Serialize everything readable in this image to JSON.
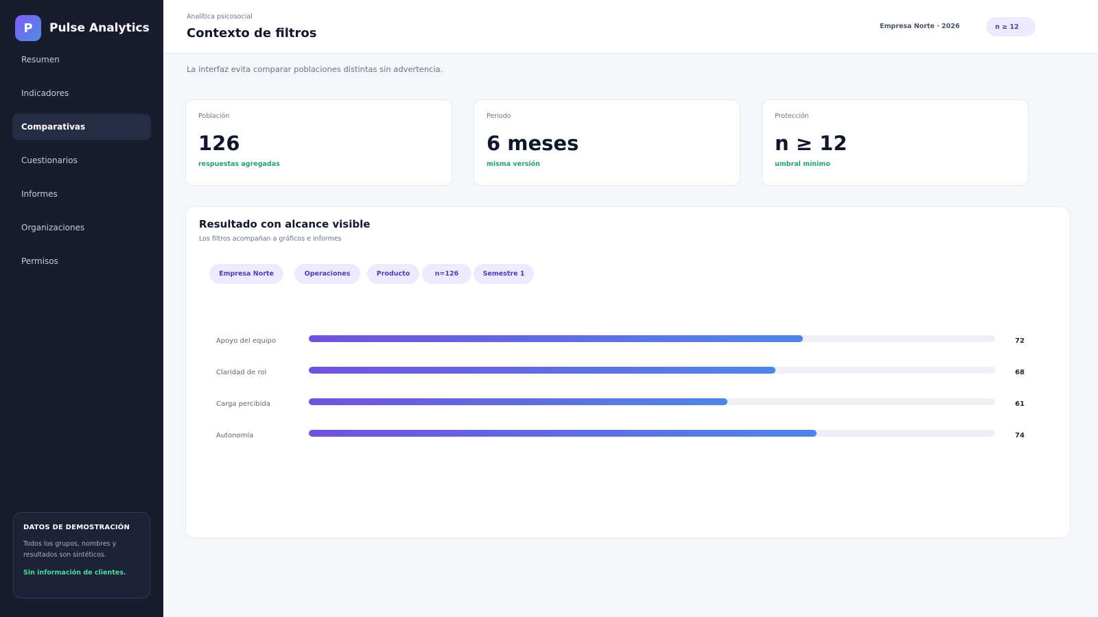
{
  "app": {
    "logo_letter": "P",
    "name": "Pulse Analytics"
  },
  "sidebar": {
    "items": [
      {
        "label": "Resumen"
      },
      {
        "label": "Indicadores"
      },
      {
        "label": "Comparativas",
        "active": true
      },
      {
        "label": "Cuestionarios"
      },
      {
        "label": "Informes"
      },
      {
        "label": "Organizaciones"
      },
      {
        "label": "Permisos"
      }
    ],
    "demo": {
      "title": "DATOS DE DEMOSTRACIÓN",
      "text": "Todos los grupos, nombres y resultados son sintéticos.",
      "note": "Sin información de clientes."
    }
  },
  "header": {
    "eyebrow": "Analítica psicosocial",
    "title": "Contexto de filtros",
    "org": "Empresa Norte · 2026",
    "threshold": "n ≥ 12"
  },
  "subtitle": "La interfaz evita comparar poblaciones distintas sin advertencia.",
  "stats": [
    {
      "label": "Población",
      "value": "126",
      "hint": "respuestas agregadas"
    },
    {
      "label": "Periodo",
      "value": "6 meses",
      "hint": "misma versión"
    },
    {
      "label": "Protección",
      "value": "n ≥ 12",
      "hint": "umbral mínimo"
    }
  ],
  "panel": {
    "title": "Resultado con alcance visible",
    "subtitle": "Los filtros acompañan a gráficos e informes",
    "chips": [
      "Empresa Norte",
      "Operaciones",
      "Producto",
      "n=126",
      "Semestre 1"
    ],
    "scale_max": 100,
    "bars": [
      {
        "label": "Apoyo del equipo",
        "value": 72
      },
      {
        "label": "Claridad de rol",
        "value": 68
      },
      {
        "label": "Carga percibida",
        "value": 61
      },
      {
        "label": "Autonomía",
        "value": 74
      }
    ]
  },
  "colors": {
    "sidebar_bg": "#181c2e",
    "accent_purple": "#7152dc",
    "accent_blue": "#4f86e6",
    "chip_bg": "#ede9fe",
    "chip_text": "#4c3fb0",
    "success_green": "#22a06b",
    "demo_note_green": "#4ade9a"
  }
}
